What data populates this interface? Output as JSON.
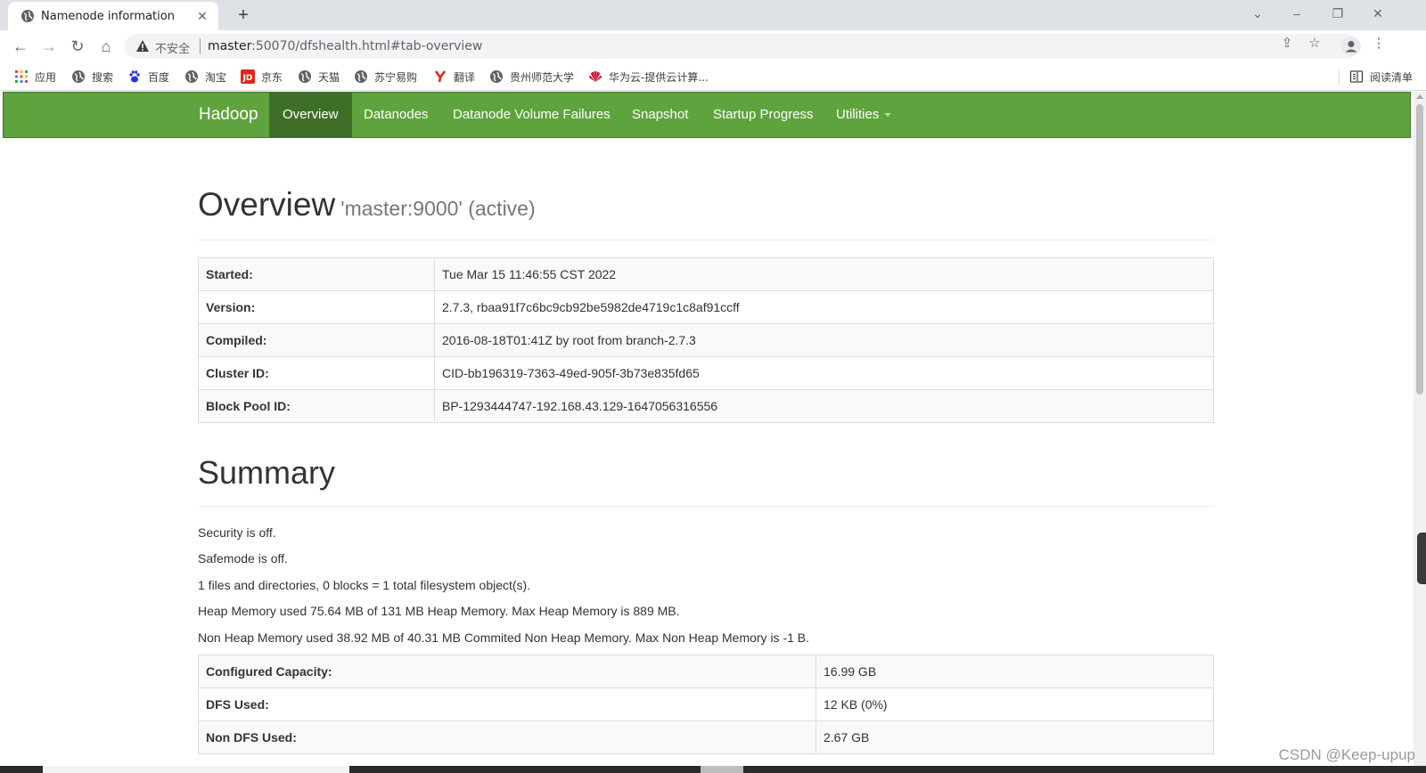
{
  "browser": {
    "tab_title": "Namenode information",
    "insecure_label": "不安全",
    "url_host": "master",
    "url_path": ":50070/dfshealth.html#tab-overview",
    "bookmarks": [
      {
        "label": "应用",
        "icon": "apps-grid-icon"
      },
      {
        "label": "搜索",
        "icon": "globe-icon"
      },
      {
        "label": "百度",
        "icon": "baidu-paw-icon"
      },
      {
        "label": "淘宝",
        "icon": "globe-icon"
      },
      {
        "label": "京东",
        "icon": "jd-icon"
      },
      {
        "label": "天猫",
        "icon": "globe-icon"
      },
      {
        "label": "苏宁易购",
        "icon": "globe-icon"
      },
      {
        "label": "翻译",
        "icon": "youdao-icon"
      },
      {
        "label": "贵州师范大学",
        "icon": "globe-icon"
      },
      {
        "label": "华为云-提供云计算...",
        "icon": "huawei-icon"
      }
    ],
    "reading_list": "阅读清单",
    "colors": {
      "jd": "#e1251b",
      "huawei": "#cf0a2c",
      "baidu": "#2932e1",
      "youdao": "#e1251b"
    }
  },
  "hadoop": {
    "brand": "Hadoop",
    "nav": [
      "Overview",
      "Datanodes",
      "Datanode Volume Failures",
      "Snapshot",
      "Startup Progress",
      "Utilities"
    ],
    "active_nav": "Overview",
    "colors": {
      "navbar": "#5fa33e",
      "active": "#3f6f27"
    }
  },
  "overview": {
    "title": "Overview",
    "subtitle": "'master:9000' (active)",
    "rows": [
      {
        "key": "Started:",
        "value": "Tue Mar 15 11:46:55 CST 2022"
      },
      {
        "key": "Version:",
        "value": "2.7.3, rbaa91f7c6bc9cb92be5982de4719c1c8af91ccff"
      },
      {
        "key": "Compiled:",
        "value": "2016-08-18T01:41Z by root from branch-2.7.3"
      },
      {
        "key": "Cluster ID:",
        "value": "CID-bb196319-7363-49ed-905f-3b73e835fd65"
      },
      {
        "key": "Block Pool ID:",
        "value": "BP-1293444747-192.168.43.129-1647056316556"
      }
    ]
  },
  "summary": {
    "title": "Summary",
    "lines": [
      "Security is off.",
      "Safemode is off.",
      "1 files and directories, 0 blocks = 1 total filesystem object(s).",
      "Heap Memory used 75.64 MB of 131 MB Heap Memory. Max Heap Memory is 889 MB.",
      "Non Heap Memory used 38.92 MB of 40.31 MB Commited Non Heap Memory. Max Non Heap Memory is -1 B."
    ],
    "rows": [
      {
        "key": "Configured Capacity:",
        "value": "16.99 GB"
      },
      {
        "key": "DFS Used:",
        "value": "12 KB (0%)"
      },
      {
        "key": "Non DFS Used:",
        "value": "2.67 GB"
      }
    ]
  },
  "watermark": "CSDN @Keep-upup"
}
